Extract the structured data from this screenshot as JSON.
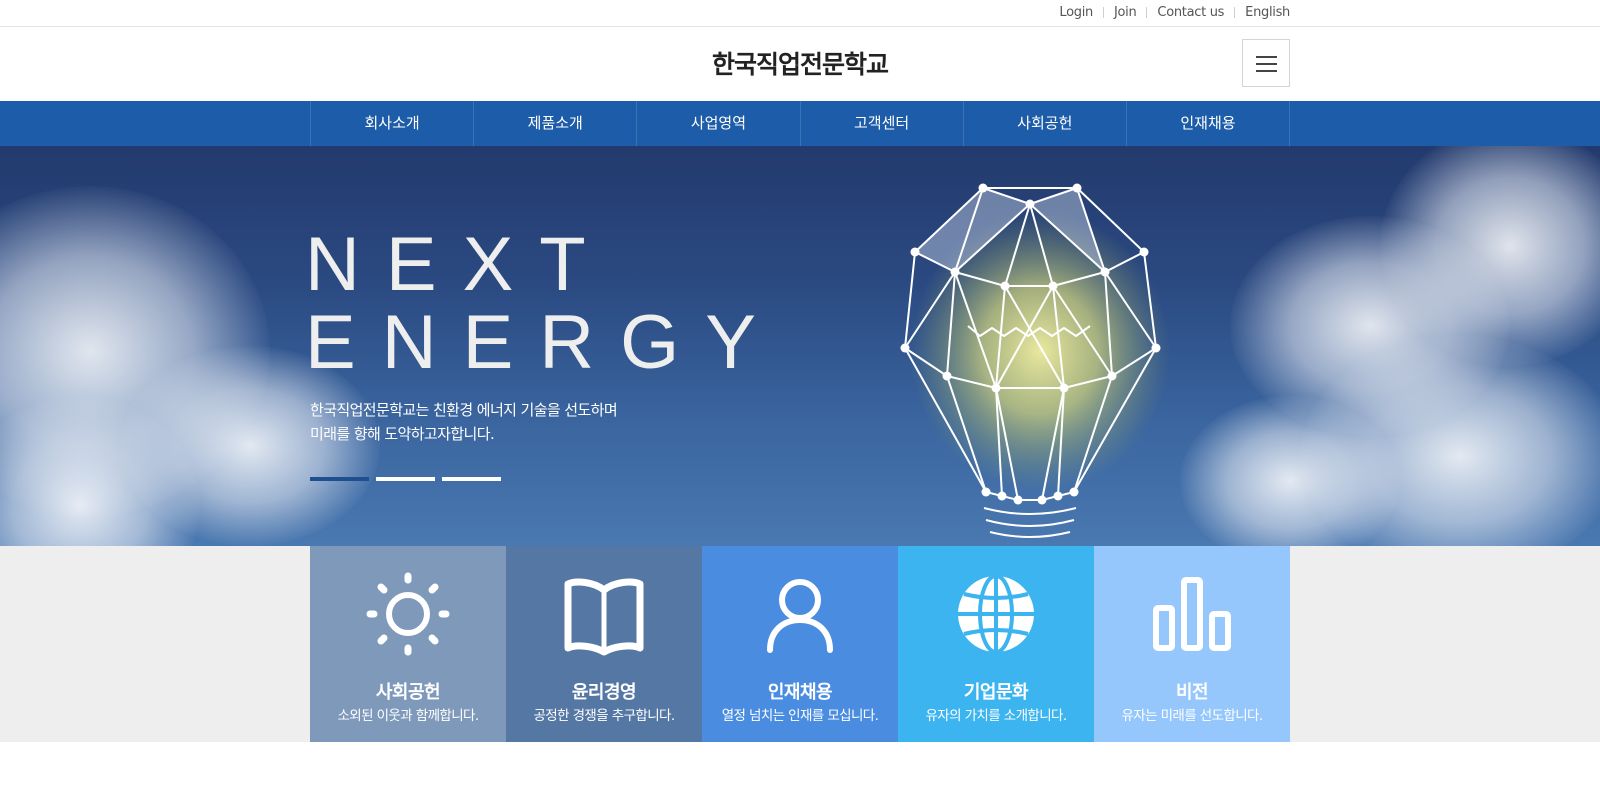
{
  "util_nav": [
    "Login",
    "Join",
    "Contact us",
    "English"
  ],
  "site": {
    "title": "한국직업전문학교"
  },
  "gnb": [
    "회사소개",
    "제품소개",
    "사업영역",
    "고객센터",
    "사회공헌",
    "인재채용"
  ],
  "hero": {
    "title_line1": "NEXT",
    "title_line2": "ENERGY",
    "desc_line1": "한국직업전문학교는 친환경 에너지 기술을 선도하며",
    "desc_line2": "미래를 향해 도약하고자합니다.",
    "slides": 3,
    "active_slide": 1
  },
  "quick": [
    {
      "title": "사회공헌",
      "desc": "소외된 이웃과 함께합니다.",
      "icon": "sun-icon",
      "color": "#7f99bb"
    },
    {
      "title": "윤리경영",
      "desc": "공정한 경쟁을 추구합니다.",
      "icon": "book-icon",
      "color": "#5577a4"
    },
    {
      "title": "인재채용",
      "desc": "열정 넘치는 인재를 모십니다.",
      "icon": "person-icon",
      "color": "#4a8de0"
    },
    {
      "title": "기업문화",
      "desc": "유자의 가치를 소개합니다.",
      "icon": "globe-icon",
      "color": "#3bb4ef"
    },
    {
      "title": "비전",
      "desc": "유자는 미래를 선도합니다.",
      "icon": "bar-chart-icon",
      "color": "#95c7fc"
    }
  ]
}
